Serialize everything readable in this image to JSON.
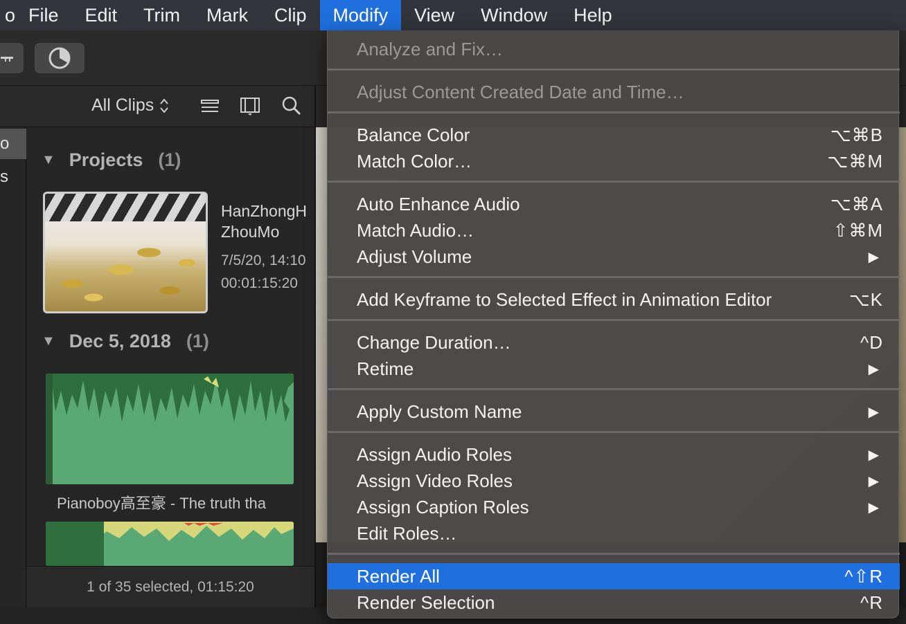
{
  "menubar": {
    "partial_left": "o",
    "items": [
      "File",
      "Edit",
      "Trim",
      "Mark",
      "Clip",
      "Modify",
      "View",
      "Window",
      "Help"
    ],
    "active": "Modify"
  },
  "browser": {
    "filter_label": "All Clips",
    "sidebar_partial": [
      "o",
      "s"
    ],
    "sections": [
      {
        "title": "Projects",
        "count": "(1)"
      },
      {
        "title": "Dec 5, 2018",
        "count": "(1)"
      }
    ],
    "project": {
      "name_line1": "HanZhongH",
      "name_line2": "ZhouMo",
      "date": "7/5/20, 14:10",
      "duration": "00:01:15:20"
    },
    "clip_label": "Pianoboy高至豪 - The truth tha",
    "footer": "1 of 35 selected, 01:15:20"
  },
  "menu": {
    "items": [
      {
        "label": "Analyze and Fix…",
        "shortcut": "",
        "disabled": true
      },
      {
        "label": "Adjust Content Created Date and Time…",
        "shortcut": "",
        "disabled": true
      },
      {
        "label": "Balance Color",
        "shortcut": "⌥⌘B"
      },
      {
        "label": "Match Color…",
        "shortcut": "⌥⌘M"
      },
      {
        "label": "Auto Enhance Audio",
        "shortcut": "⌥⌘A"
      },
      {
        "label": "Match Audio…",
        "shortcut": "⇧⌘M"
      },
      {
        "label": "Adjust Volume",
        "shortcut": "▶"
      },
      {
        "label": "Add Keyframe to Selected Effect in Animation Editor",
        "shortcut": "⌥K"
      },
      {
        "label": "Change Duration…",
        "shortcut": "^D"
      },
      {
        "label": "Retime",
        "shortcut": "▶"
      },
      {
        "label": "Apply Custom Name",
        "shortcut": "▶"
      },
      {
        "label": "Assign Audio Roles",
        "shortcut": "▶"
      },
      {
        "label": "Assign Video Roles",
        "shortcut": "▶"
      },
      {
        "label": "Assign Caption Roles",
        "shortcut": "▶"
      },
      {
        "label": "Edit Roles…",
        "shortcut": ""
      },
      {
        "label": "Render All",
        "shortcut": "^⇧R",
        "highlighted": true
      },
      {
        "label": "Render Selection",
        "shortcut": "^R"
      }
    ]
  },
  "colors": {
    "accent": "#1f6fde",
    "menu_bg": "#4a4947",
    "waveform_green": "#5aa874"
  }
}
